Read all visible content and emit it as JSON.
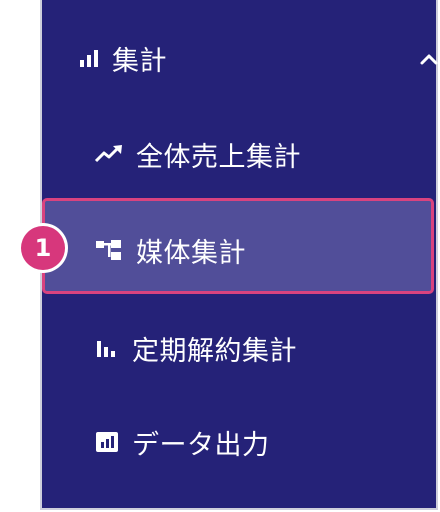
{
  "sidebar": {
    "group": {
      "label": "集計",
      "icon": "bar-chart-icon",
      "state_icon": "chevron-up-icon"
    },
    "items": [
      {
        "label": "全体売上集計",
        "icon": "trend-line-icon"
      },
      {
        "label": "媒体集計",
        "icon": "sitemap-icon",
        "active": true
      },
      {
        "label": "定期解約集計",
        "icon": "bar-chart-icon"
      },
      {
        "label": "データ出力",
        "icon": "chart-box-icon"
      }
    ]
  },
  "annotation": {
    "step_number": "1"
  },
  "colors": {
    "sidebar_bg": "#252278",
    "active_bg": "#514e99",
    "highlight_border": "#d9437f",
    "badge": "#d7377c"
  }
}
